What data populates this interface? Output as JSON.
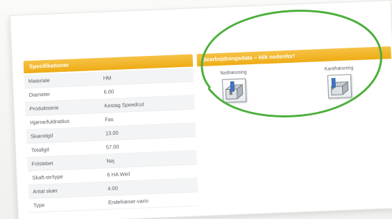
{
  "specifications": {
    "header": "Specifikationer",
    "rows": [
      {
        "label": "Materiale",
        "value": "HM"
      },
      {
        "label": "Diameter",
        "value": "6.00"
      },
      {
        "label": "Produktserie",
        "value": "Kestag Speedcut"
      },
      {
        "label": "Hjørne/fuldradius",
        "value": "Fas"
      },
      {
        "label": "Skærelgd",
        "value": "13.00"
      },
      {
        "label": "Totallgd",
        "value": "57.00"
      },
      {
        "label": "Fritslebet",
        "value": "Nej"
      },
      {
        "label": "Skaft-str/type",
        "value": "6 HA Weil"
      },
      {
        "label": "Antal skær",
        "value": "4.00"
      },
      {
        "label": "Type",
        "value": "Endefræser-vario"
      }
    ]
  },
  "machining": {
    "header": "Bearbejdningsdata – klik nedenfor!",
    "operations": [
      {
        "label": "Notfræsning",
        "icon": "slot-milling-icon"
      },
      {
        "label": "Kantfræsning",
        "icon": "edge-milling-icon"
      }
    ]
  },
  "colors": {
    "header_bg": "#eeac16",
    "highlight": "#4caf3a",
    "tool_blue": "#3f74c9"
  }
}
